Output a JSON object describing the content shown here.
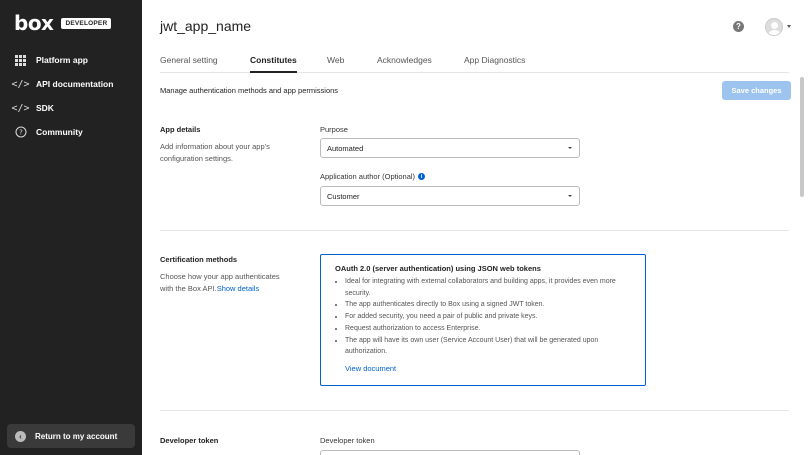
{
  "sidebar": {
    "logo": "box",
    "badge": "DEVELOPER",
    "items": [
      {
        "label": "Platform app",
        "icon": "grid-icon"
      },
      {
        "label": "API documentation",
        "icon": "code-icon"
      },
      {
        "label": "SDK",
        "icon": "code-icon"
      },
      {
        "label": "Community",
        "icon": "help-circle-icon"
      }
    ],
    "return_label": "Return to my account"
  },
  "header": {
    "title": "jwt_app_name"
  },
  "tabs": [
    {
      "label": "General setting",
      "active": false
    },
    {
      "label": "Constitutes",
      "active": true
    },
    {
      "label": "Web",
      "active": false
    },
    {
      "label": "Acknowledges",
      "active": false
    },
    {
      "label": "App Diagnostics",
      "active": false
    }
  ],
  "page": {
    "subtitle": "Manage authentication methods and app permissions",
    "save_label": "Save changes"
  },
  "app_details": {
    "title": "App details",
    "description": "Add information about your app's configuration settings.",
    "purpose_label": "Purpose",
    "purpose_value": "Automated",
    "author_label": "Application author (Optional)",
    "author_value": "Customer"
  },
  "cert_methods": {
    "title": "Certification methods",
    "description": "Choose how your app authenticates with the Box API.",
    "show_details": "Show details",
    "card": {
      "title": "OAuth 2.0 (server authentication) using JSON web tokens",
      "bullets": [
        "Ideal for integrating with external collaborators and building apps, it provides even more security.",
        "The app authenticates directly to Box using a signed JWT token.",
        "For added security, you need a pair of public and private keys.",
        "Request authorization to access Enterprise.",
        "The app will have its own user (Service Account User) that will be generated upon authorization."
      ],
      "link": "View document"
    }
  },
  "developer_token": {
    "title": "Developer token",
    "label": "Developer token"
  },
  "colors": {
    "sidebar_bg": "#222222",
    "accent": "#0061d5",
    "save_disabled": "#9cc4ee"
  }
}
